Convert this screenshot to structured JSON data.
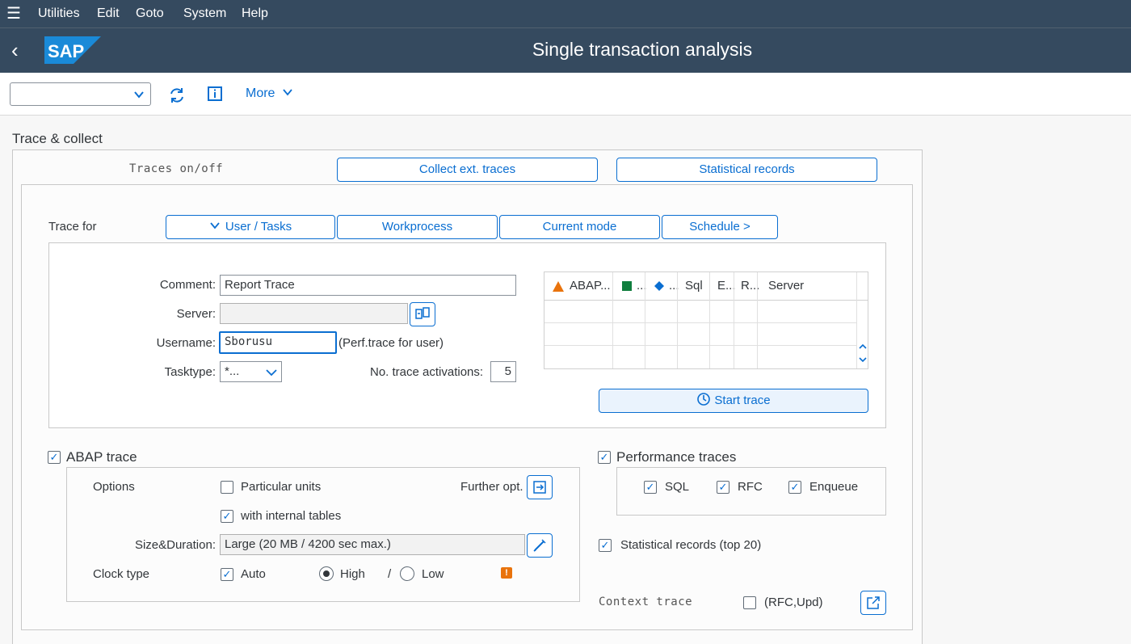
{
  "menu": {
    "items": [
      "Utilities",
      "Edit",
      "Goto",
      "System",
      "Help"
    ]
  },
  "shell": {
    "title": "Single transaction analysis",
    "logo_text": "SAP"
  },
  "toolbar": {
    "command_value": "",
    "more_label": "More"
  },
  "trace_collect": {
    "group_title": "Trace & collect",
    "traces_onoff_label": "Traces on/off",
    "collect_ext_label": "Collect ext. traces",
    "statistical_records_label": "Statistical records",
    "trace_for_label": "Trace for",
    "tabs": [
      "User / Tasks",
      "Workprocess",
      "Current mode",
      "Schedule >"
    ]
  },
  "form": {
    "comment_label": "Comment:",
    "comment_value": "Report Trace",
    "server_label": "Server:",
    "server_value": "",
    "username_label": "Username:",
    "username_value": "Sborusu",
    "username_hint": "(Perf.trace for user)",
    "tasktype_label": "Tasktype:",
    "tasktype_value": "*...",
    "activations_label": "No. trace activations:",
    "activations_value": "5"
  },
  "table": {
    "columns": [
      "ABAP...",
      "...",
      "...",
      "Sql",
      "E...",
      "R...",
      "Server"
    ],
    "icon_colors": {
      "triangle": "#e9730c",
      "square": "#107e3e",
      "diamond": "#0a6ed1"
    }
  },
  "start_trace_label": "Start trace",
  "abap": {
    "title": "ABAP trace",
    "checked": true,
    "options_label": "Options",
    "particular_units_label": "Particular units",
    "particular_units_checked": false,
    "further_opt_label": "Further opt.",
    "internal_tables_label": "with internal tables",
    "internal_tables_checked": true,
    "size_label": "Size&Duration:",
    "size_value": "Large (20 MB / 4200 sec max.)",
    "clock_label": "Clock type",
    "auto_label": "Auto",
    "auto_checked": true,
    "high_label": "High",
    "slash": "/",
    "low_label": "Low",
    "high_selected": true,
    "warning_glyph": "!"
  },
  "perf": {
    "title": "Performance traces",
    "checked": true,
    "sql_label": "SQL",
    "rfc_label": "RFC",
    "enqueue_label": "Enqueue",
    "stat_top_label": "Statistical records (top 20)",
    "context_trace_label": "Context trace",
    "rfc_upd_label": "(RFC,Upd)"
  }
}
